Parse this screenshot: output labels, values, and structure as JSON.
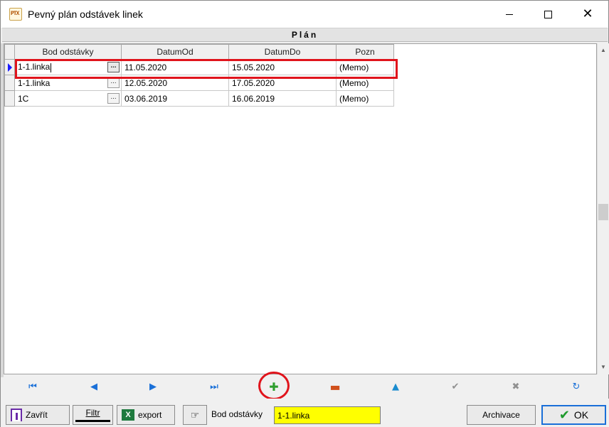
{
  "window": {
    "title": "Pevný plán odstávek linek",
    "icon_label": "PTX"
  },
  "section": {
    "title": "Plán"
  },
  "grid": {
    "columns": [
      "Bod odstávky",
      "DatumOd",
      "DatumDo",
      "Pozn"
    ],
    "rows": [
      {
        "bod": "1-1.linka",
        "od": "11.05.2020",
        "do": "15.05.2020",
        "pozn": "(Memo)"
      },
      {
        "bod": "1-1.linka",
        "od": "12.05.2020",
        "do": "17.05.2020",
        "pozn": "(Memo)"
      },
      {
        "bod": "1C",
        "od": "03.06.2019",
        "do": "16.06.2019",
        "pozn": "(Memo)"
      }
    ],
    "ellipsis": "...",
    "selected_row": 0
  },
  "toolbar": {
    "close_label": "Zavřít",
    "filter_label": "Filtr",
    "export_label": "export",
    "search_field_label": "Bod odstávky",
    "search_value": "1-1.linka",
    "archive_label": "Archivace",
    "ok_label": "OK"
  },
  "colors": {
    "highlight": "#e0141c",
    "search_bg": "#ffff00",
    "ok_border": "#1a6fd8"
  }
}
